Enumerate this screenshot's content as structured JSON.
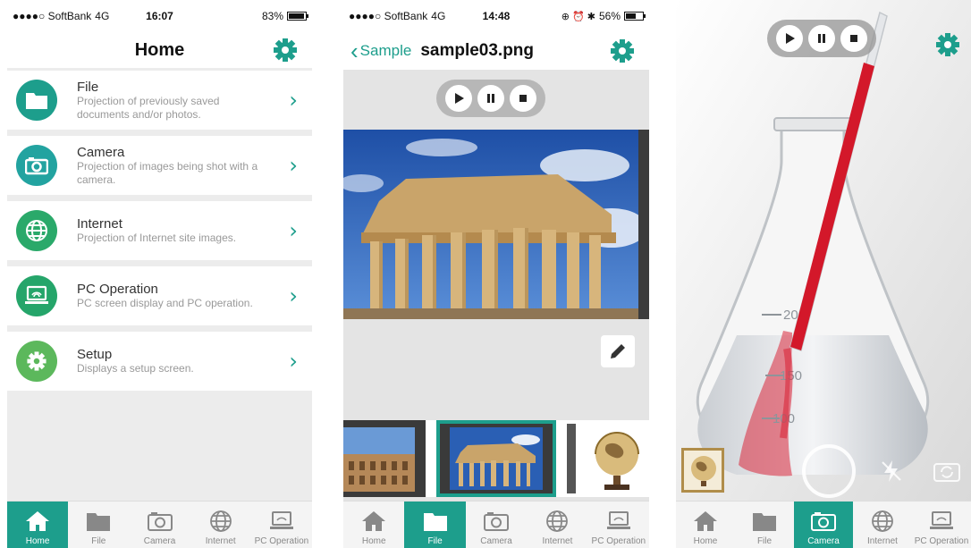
{
  "status": {
    "s1": {
      "carrier": "●●●●○ SoftBank",
      "network": "4G",
      "time": "16:07",
      "battery": "83%",
      "battery_level": 0.83
    },
    "s2": {
      "carrier": "●●●●○ SoftBank",
      "network": "4G",
      "time": "14:48",
      "battery": "56%",
      "battery_level": 0.56
    }
  },
  "home": {
    "title": "Home",
    "items": [
      {
        "title": "File",
        "desc": "Projection of previously saved documents and/or photos.",
        "icon": "folder-icon"
      },
      {
        "title": "Camera",
        "desc": "Projection of images being shot with a camera.",
        "icon": "camera-icon"
      },
      {
        "title": "Internet",
        "desc": "Projection of Internet site images.",
        "icon": "globe-icon"
      },
      {
        "title": "PC Operation",
        "desc": "PC screen display and PC operation.",
        "icon": "laptop-icon"
      },
      {
        "title": "Setup",
        "desc": "Displays a setup screen.",
        "icon": "gear-icon"
      }
    ]
  },
  "file_view": {
    "back_label": "Sample",
    "title": "sample03.png"
  },
  "tabs": [
    "Home",
    "File",
    "Camera",
    "Internet",
    "PC Operation"
  ],
  "flask_marks": [
    "200",
    "150",
    "100"
  ],
  "colors": {
    "accent": "#1d9e8c",
    "file": "#1d9e8c",
    "camera": "#22a3a0",
    "internet": "#2aa96a",
    "pc": "#25a56a",
    "setup": "#5cb85c"
  }
}
